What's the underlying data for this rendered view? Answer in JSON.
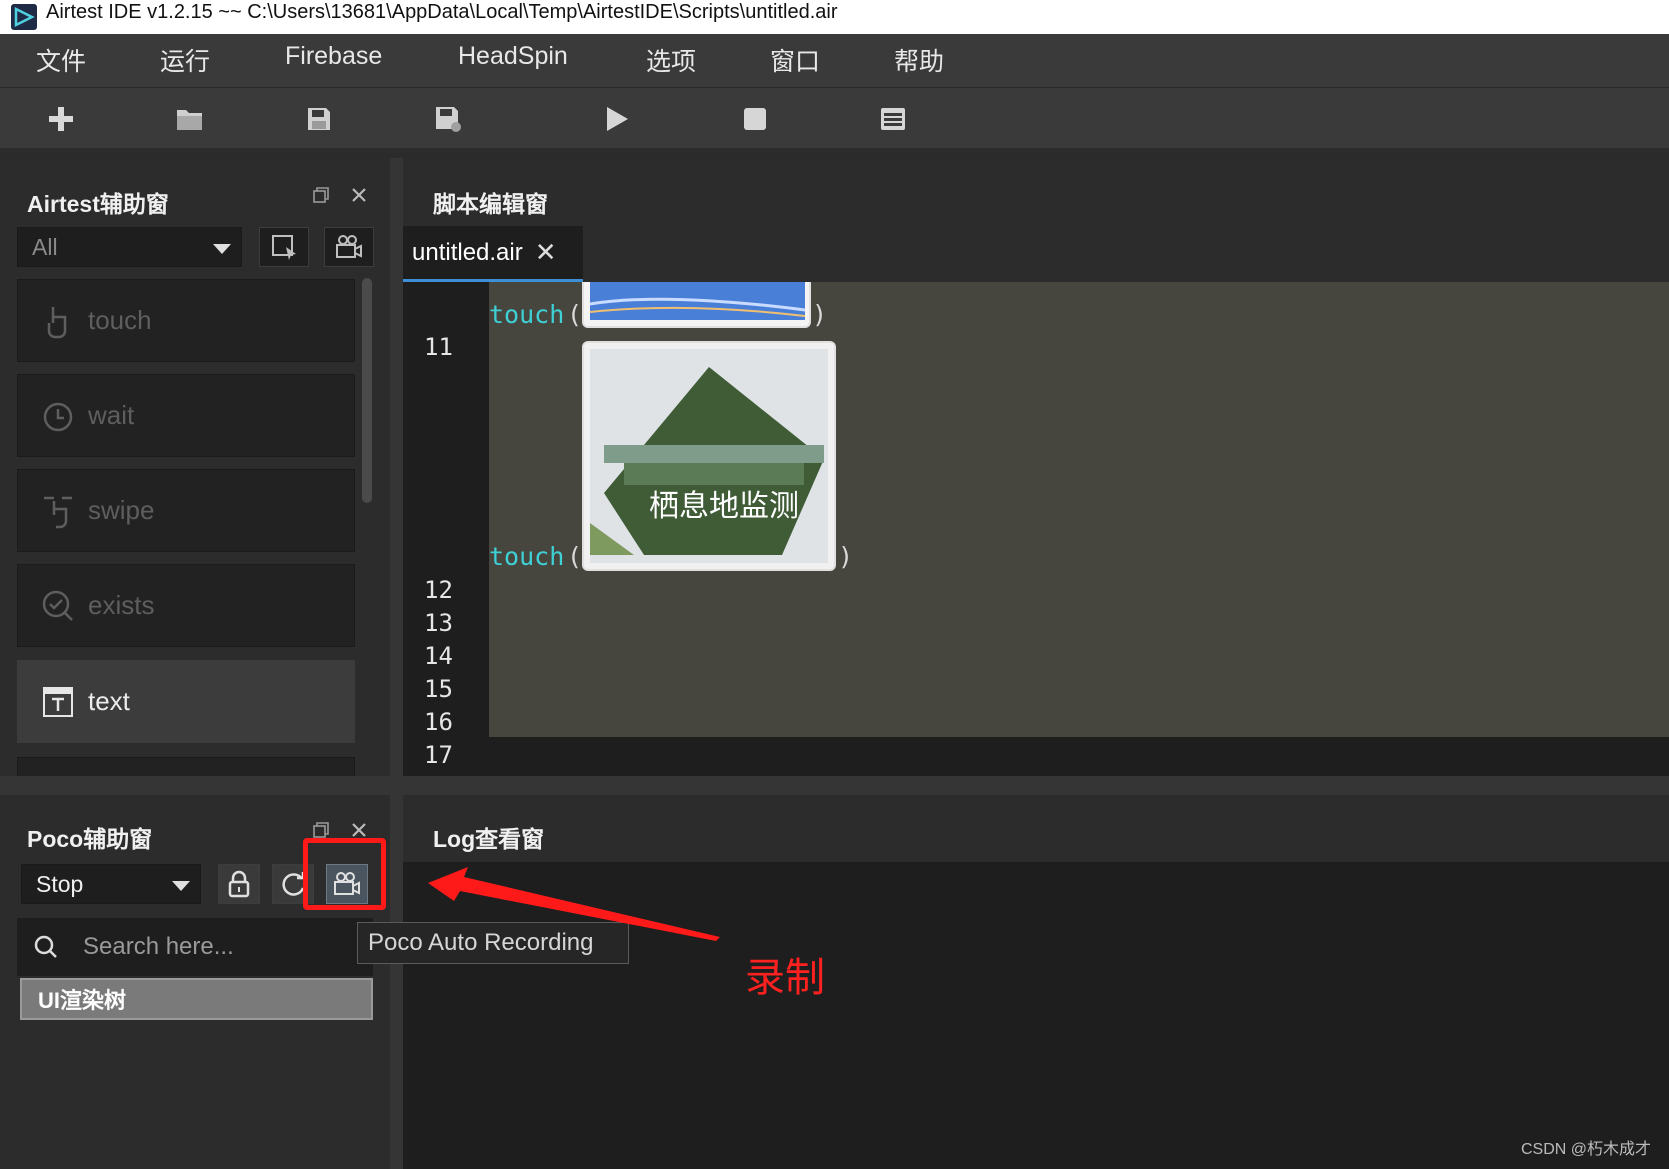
{
  "window": {
    "title": "Airtest IDE v1.2.15 ~~ C:\\Users\\13681\\AppData\\Local\\Temp\\AirtestIDE\\Scripts\\untitled.air"
  },
  "menu": [
    "文件",
    "运行",
    "Firebase",
    "HeadSpin",
    "选项",
    "窗口",
    "帮助"
  ],
  "toolbar": {
    "icons": [
      "plus-icon",
      "open-folder-icon",
      "save-icon",
      "save-as-icon",
      "play-icon",
      "stop-icon",
      "log-list-icon"
    ]
  },
  "airtest_panel": {
    "title": "Airtest辅助窗",
    "filter_value": "All",
    "actions": [
      {
        "label": "touch",
        "enabled": false
      },
      {
        "label": "wait",
        "enabled": false
      },
      {
        "label": "swipe",
        "enabled": false
      },
      {
        "label": "exists",
        "enabled": false
      },
      {
        "label": "text",
        "enabled": true
      }
    ]
  },
  "editor": {
    "title": "脚本编辑窗",
    "tab_label": "untitled.air",
    "tab_close": "✕",
    "line_numbers": [
      "11",
      "12",
      "13",
      "14",
      "15",
      "16",
      "17"
    ],
    "keyword": "touch",
    "open_paren": "(",
    "close_paren": ")",
    "image_caption": "栖息地监测"
  },
  "poco_panel": {
    "title": "Poco辅助窗",
    "mode_value": "Stop",
    "search_placeholder": "Search here...",
    "tree_label": "UI渲染树"
  },
  "log_panel": {
    "title": "Log查看窗"
  },
  "tooltip": "Poco Auto Recording",
  "annotation": "录制",
  "watermark": "CSDN @朽木成才",
  "colors": {
    "accent_tab": "#3d8fd6",
    "keyword": "#3fd0d6",
    "annotation_red": "#ff1a1a",
    "code_bg": "#46463f"
  }
}
